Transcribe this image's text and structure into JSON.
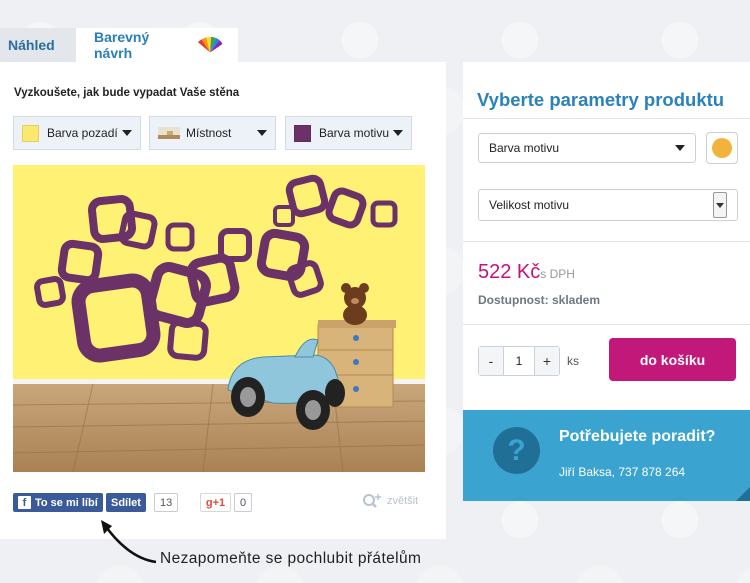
{
  "tabs": [
    {
      "label": "Náhled",
      "active": false
    },
    {
      "label": "Barevný návrh",
      "active": true
    }
  ],
  "left": {
    "title": "Vyzkoušete, jak bude vypadat Vaše stěna",
    "dropdowns": [
      {
        "label": "Barva pozadí",
        "swatch": "#fde86f"
      },
      {
        "label": "Místnost",
        "swatch": "room-thumbnail-icon"
      },
      {
        "label": "Barva motivu",
        "swatch": "#6a3267"
      }
    ],
    "preview_colors": {
      "wall": "#fff174",
      "motif": "#6a3267"
    },
    "social": {
      "like_label": "To se mi líbí",
      "share_label": "Sdílet",
      "share_count": "13",
      "gplus_label": "g+1",
      "gplus_count": "0"
    },
    "zoom_label": "zvětšit"
  },
  "reminder": "Nezapomeňte se pochlubit přátelům",
  "right": {
    "title": "Vyberte parametry produktu",
    "motif_select": "Barva motivu",
    "motif_color": "#f2b33d",
    "size_select": "Velikost motivu",
    "price": "522 Kč",
    "price_suffix": "s DPH",
    "availability": "Dostupnost: skladem",
    "quantity": "1",
    "qty_minus": "-",
    "qty_plus": "+",
    "unit": "ks",
    "cart_label": "do košíku"
  },
  "help": {
    "question": "Potřebujete poradit?",
    "contact": "Jiří Baksa, 737 878 264",
    "icon": "?"
  }
}
